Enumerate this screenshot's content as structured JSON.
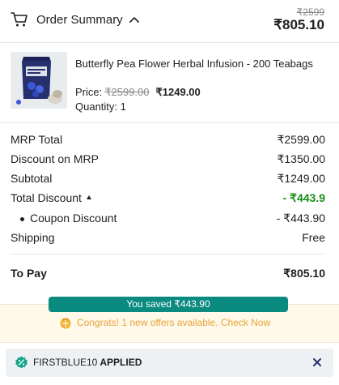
{
  "header": {
    "title": "Order Summary",
    "original_total": "₹2599",
    "total": "₹805.10"
  },
  "product": {
    "name": "Butterfly Pea Flower Herbal Infusion - 200 Teabags",
    "price_label": "Price:",
    "mrp": "₹2599.00",
    "price": "₹1249.00",
    "quantity": "Quantity: 1"
  },
  "summary": {
    "mrp_total": {
      "label": "MRP Total",
      "value": "₹2599.00"
    },
    "discount_mrp": {
      "label": "Discount on MRP",
      "value": "₹1350.00"
    },
    "subtotal": {
      "label": "Subtotal",
      "value": "₹1249.00"
    },
    "total_discount": {
      "label": "Total Discount",
      "value": "- ₹443.9"
    },
    "coupon_discount": {
      "label": "Coupon Discount",
      "value": "- ₹443.90"
    },
    "shipping": {
      "label": "Shipping",
      "value": "Free"
    },
    "to_pay": {
      "label": "To Pay",
      "value": "₹805.10"
    }
  },
  "offers": {
    "saved": "You saved ₹443.90",
    "congrats": "Congrats! 1 new offers available. Check Now"
  },
  "coupon": {
    "code": "FIRSTBLUE10",
    "status": "APPLIED"
  },
  "colors": {
    "accent_teal": "#0b8a7f",
    "discount_green": "#1a8f1a",
    "offer_orange": "#e7a33a"
  }
}
